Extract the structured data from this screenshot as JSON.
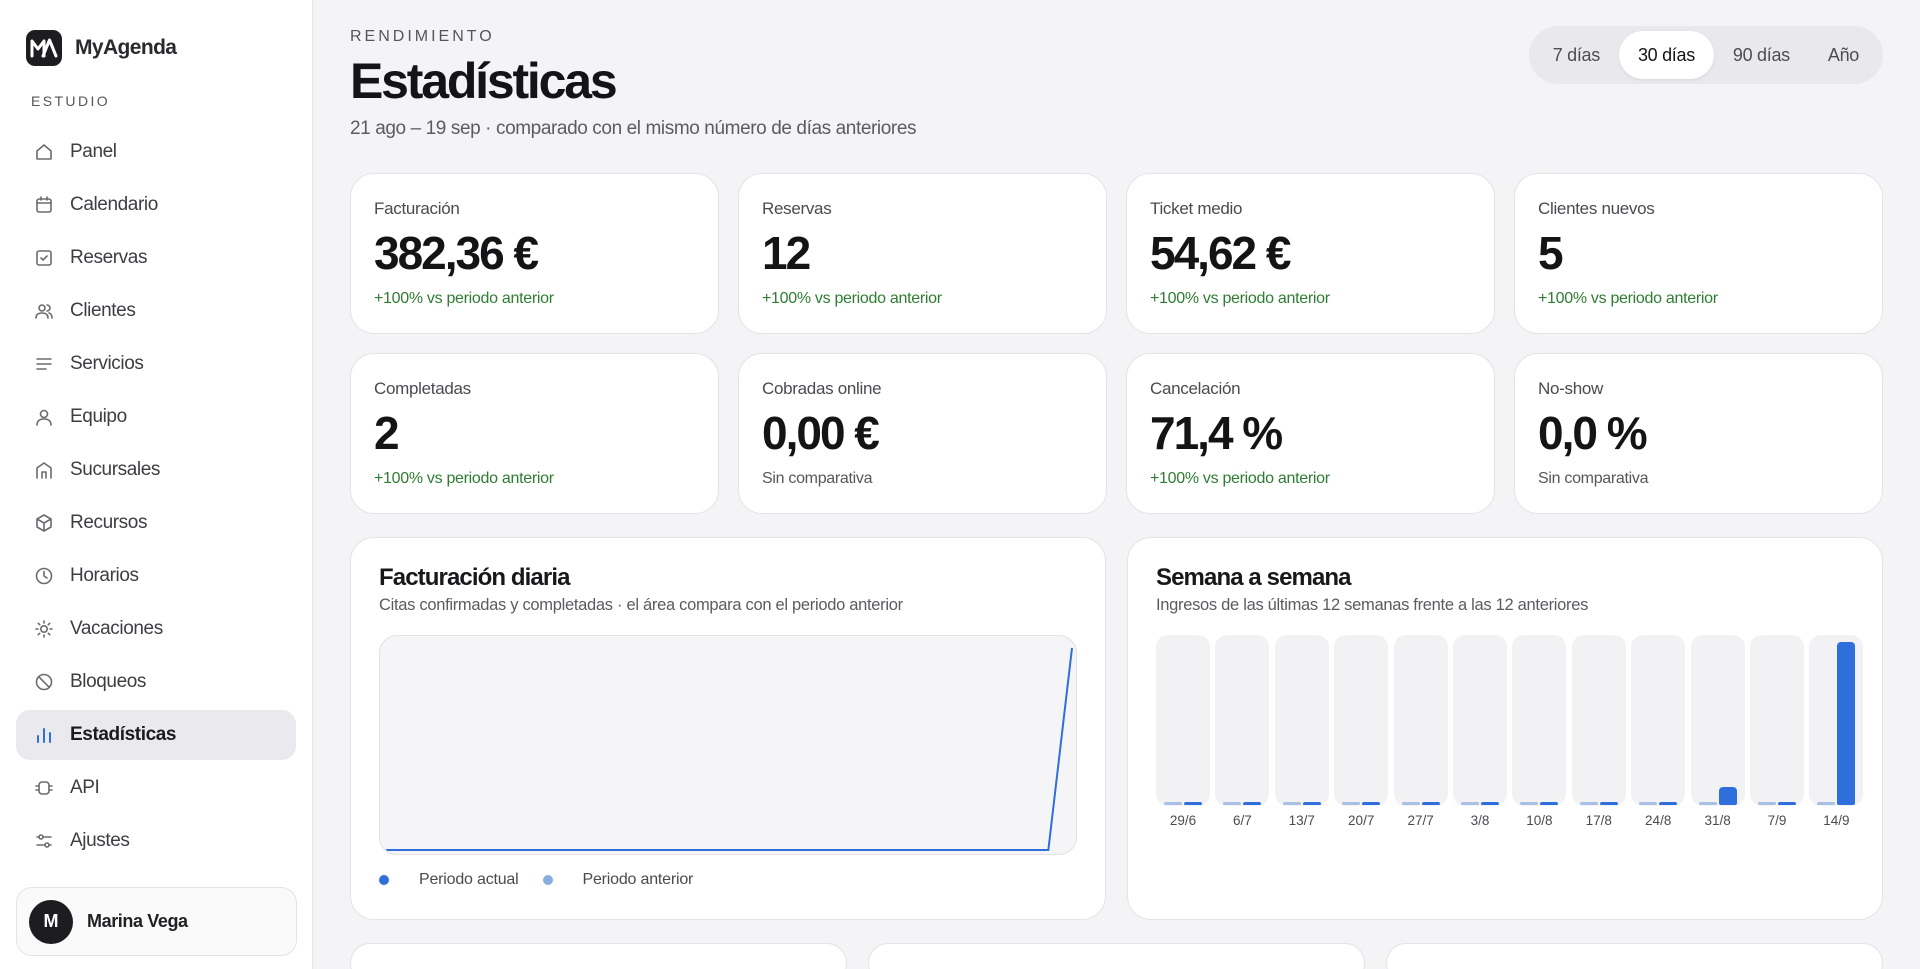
{
  "app": {
    "name": "MyAgenda",
    "logo_text": "MA"
  },
  "sidebar": {
    "section_label": "ESTUDIO",
    "items": [
      {
        "label": "Panel",
        "icon": "home-icon"
      },
      {
        "label": "Calendario",
        "icon": "calendar-icon"
      },
      {
        "label": "Reservas",
        "icon": "checkbox-icon"
      },
      {
        "label": "Clientes",
        "icon": "users-icon"
      },
      {
        "label": "Servicios",
        "icon": "list-icon"
      },
      {
        "label": "Equipo",
        "icon": "user-icon"
      },
      {
        "label": "Sucursales",
        "icon": "building-icon"
      },
      {
        "label": "Recursos",
        "icon": "box-icon"
      },
      {
        "label": "Horarios",
        "icon": "clock-icon"
      },
      {
        "label": "Vacaciones",
        "icon": "sun-icon"
      },
      {
        "label": "Bloqueos",
        "icon": "block-icon"
      },
      {
        "label": "Estadísticas",
        "icon": "bar-chart-icon",
        "active": true
      },
      {
        "label": "API",
        "icon": "api-icon"
      },
      {
        "label": "Ajustes",
        "icon": "sliders-icon"
      }
    ],
    "user": {
      "initial": "M",
      "name": "Marina Vega"
    }
  },
  "header": {
    "eyebrow": "RENDIMIENTO",
    "title": "Estadísticas",
    "subtitle": "21 ago – 19 sep · comparado con el mismo número de días anteriores",
    "ranges": [
      "7 días",
      "30 días",
      "90 días",
      "Año"
    ],
    "active_range": "30 días"
  },
  "kpis": [
    {
      "label": "Facturación",
      "value": "382,36 €",
      "delta": "+100% vs periodo anterior",
      "positive": true
    },
    {
      "label": "Reservas",
      "value": "12",
      "delta": "+100% vs periodo anterior",
      "positive": true
    },
    {
      "label": "Ticket medio",
      "value": "54,62 €",
      "delta": "+100% vs periodo anterior",
      "positive": true
    },
    {
      "label": "Clientes nuevos",
      "value": "5",
      "delta": "+100% vs periodo anterior",
      "positive": true
    },
    {
      "label": "Completadas",
      "value": "2",
      "delta": "+100% vs periodo anterior",
      "positive": true
    },
    {
      "label": "Cobradas online",
      "value": "0,00 €",
      "delta": "Sin comparativa",
      "positive": false
    },
    {
      "label": "Cancelación",
      "value": "71,4 %",
      "delta": "+100% vs periodo anterior",
      "positive": true
    },
    {
      "label": "No-show",
      "value": "0,0 %",
      "delta": "Sin comparativa",
      "positive": false
    }
  ],
  "daily_card": {
    "title": "Facturación diaria",
    "subtitle": "Citas confirmadas y completadas · el área compara con el periodo anterior",
    "legend": [
      "Periodo actual",
      "Periodo anterior"
    ],
    "colors": {
      "current": "#2f6fdb",
      "previous": "#8aaee0"
    }
  },
  "weekly_card": {
    "title": "Semana a semana",
    "subtitle": "Ingresos de las últimas 12 semanas frente a las 12 anteriores"
  },
  "chart_data": [
    {
      "type": "area",
      "title": "Facturación diaria",
      "series": [
        {
          "name": "Periodo actual",
          "values": [
            0,
            0,
            0,
            0,
            0,
            0,
            0,
            0,
            0,
            0,
            0,
            0,
            0,
            0,
            0,
            0,
            0,
            0,
            0,
            0,
            0,
            0,
            0,
            0,
            0,
            0,
            0,
            0,
            0,
            1
          ]
        },
        {
          "name": "Periodo anterior",
          "values": [
            0,
            0,
            0,
            0,
            0,
            0,
            0,
            0,
            0,
            0,
            0,
            0,
            0,
            0,
            0,
            0,
            0,
            0,
            0,
            0,
            0,
            0,
            0,
            0,
            0,
            0,
            0,
            0,
            0,
            0
          ]
        }
      ]
    },
    {
      "type": "bar",
      "title": "Semana a semana",
      "categories": [
        "29/6",
        "6/7",
        "13/7",
        "20/7",
        "27/7",
        "3/8",
        "10/8",
        "17/8",
        "24/8",
        "31/8",
        "7/9",
        "14/9"
      ],
      "series": [
        {
          "values": [
            0,
            0,
            0,
            0,
            0,
            0,
            0,
            0,
            0,
            0,
            0,
            0
          ]
        },
        {
          "values": [
            0,
            0,
            0,
            0,
            0,
            0,
            0,
            0,
            0,
            0.11,
            0,
            1
          ]
        }
      ]
    }
  ]
}
